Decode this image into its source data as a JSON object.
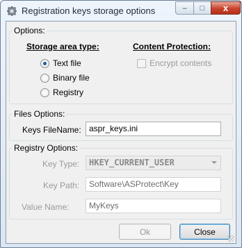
{
  "window": {
    "title": "Registration keys storage options",
    "icon": "gear-cube-icon",
    "controls": {
      "minimize": "–",
      "maximize": "□",
      "close": "x"
    }
  },
  "options": {
    "group_title": "Options:",
    "storage_heading": "Storage area type:",
    "storage_types": [
      {
        "label": "Text file",
        "checked": true
      },
      {
        "label": "Binary file",
        "checked": false
      },
      {
        "label": "Registry",
        "checked": false
      }
    ],
    "protection_heading": "Content Protection:",
    "encrypt_label": "Encrypt contents",
    "encrypt_checked": false
  },
  "files": {
    "group_title": "Files Options:",
    "filename_label": "Keys FileName:",
    "filename_value": "aspr_keys.ini"
  },
  "registry": {
    "group_title": "Registry Options:",
    "key_type_label": "Key Type:",
    "key_type_value": "HKEY_CURRENT_USER",
    "key_path_label": "Key Path:",
    "key_path_value": "Software\\ASProtect\\Key",
    "value_name_label": "Value Name:",
    "value_name_value": "MyKeys"
  },
  "buttons": {
    "ok": "Ok",
    "close": "Close"
  },
  "colors": {
    "radio_dot": "#1c5aa6",
    "close_button": "#c7432c",
    "disabled_text": "#9a9a9a"
  }
}
